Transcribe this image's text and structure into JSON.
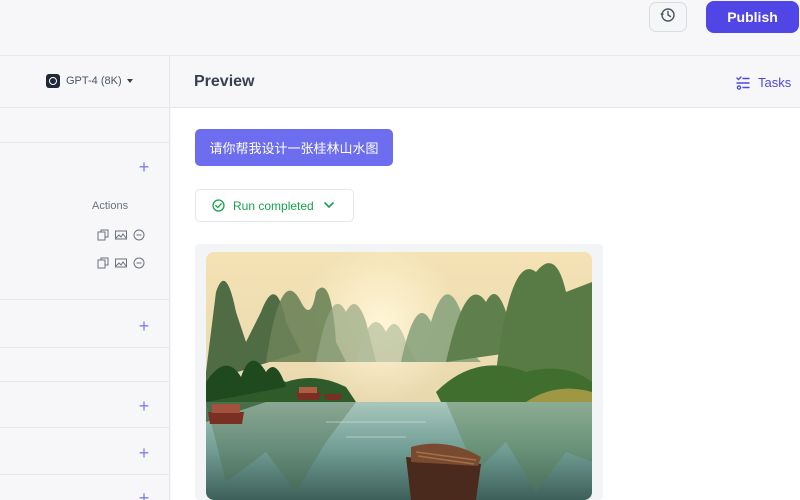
{
  "topbar": {
    "history_icon": "history-icon",
    "publish_label": "Publish",
    "accent_color": "#4f46e5"
  },
  "sidebar": {
    "model_label": "GPT-4 (8K)",
    "actions_label": "Actions"
  },
  "main": {
    "title": "Preview",
    "tasks_label": "Tasks",
    "prompt_text": "请你帮我设计一张桂林山水图",
    "run_status": "Run completed",
    "status_color": "#16a34a"
  }
}
